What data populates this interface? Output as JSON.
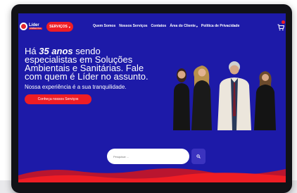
{
  "header": {
    "services_label": "SERVIÇOS",
    "nav": [
      {
        "label": "Quem Somos"
      },
      {
        "label": "Nossos Serviços"
      },
      {
        "label": "Contatos"
      },
      {
        "label": "Área do Cliente"
      },
      {
        "label": "Política de Privacidade"
      }
    ],
    "logo": {
      "name": "Líder",
      "sub": "AMBIENTAL"
    }
  },
  "hero": {
    "line1_prefix": "Há ",
    "line1_highlight": "35 anos",
    "line1_suffix": " sendo",
    "line2": "especialistas em Soluções",
    "line3": "Ambientais e Sanitárias. Fale",
    "line4": "com quem é Líder no assunto.",
    "tagline": "Nossa experiência é a sua tranquilidade.",
    "cta_label": "Conheça nossos Serviços"
  },
  "search": {
    "placeholder": "Pesquisar ..."
  },
  "colors": {
    "brand_blue": "#1d1aa8",
    "brand_red": "#ef1d24",
    "search_button": "#3b33bf"
  }
}
